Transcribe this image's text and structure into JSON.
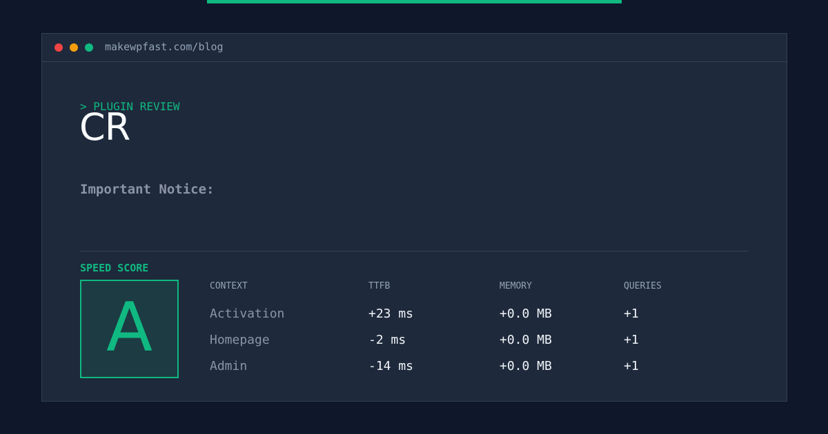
{
  "browser": {
    "url": "makewpfast.com/blog"
  },
  "post": {
    "eyebrow": "> PLUGIN REVIEW",
    "title": "CR",
    "notice": "Important Notice:"
  },
  "score": {
    "label": "SPEED SCORE",
    "grade": "A"
  },
  "table": {
    "headers": [
      "CONTEXT",
      "TTFB",
      "MEMORY",
      "QUERIES"
    ],
    "rows": [
      [
        "Activation",
        "+23 ms",
        "+0.0 MB",
        "+1"
      ],
      [
        "Homepage",
        "-2 ms",
        "+0.0 MB",
        "+1"
      ],
      [
        "Admin",
        "-14 ms",
        "+0.0 MB",
        "+1"
      ]
    ]
  },
  "colors": {
    "background": "#0f172a",
    "card": "#1e293b",
    "accent": "#10b981",
    "muted": "#94a3b8",
    "window_red": "#ef4444",
    "window_yellow": "#f59e0b",
    "window_green": "#10b981"
  }
}
